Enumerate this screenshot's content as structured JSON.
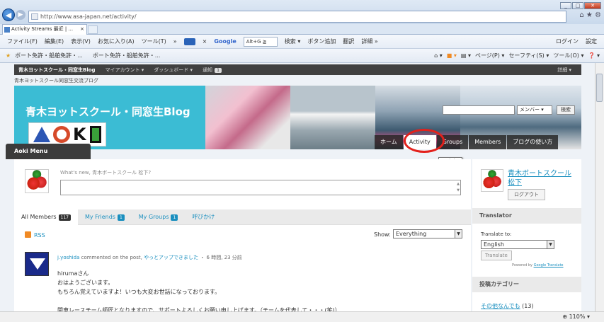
{
  "browser": {
    "url": "http://www.asa-japan.net/activity/",
    "tab_title": "Activity Streams 最近 | ...",
    "tab_close": "×",
    "menu": [
      "ファイル(F)",
      "編集(E)",
      "表示(V)",
      "お気に入り(A)",
      "ツール(T)",
      "»"
    ],
    "toolbar": {
      "google": "Google",
      "search_input": "Alt+G ≧",
      "search_btn": "検索 ▾",
      "addbutton": "ボタン追加",
      "translate": "翻訳",
      "details": "詳細 »",
      "login": "ログイン",
      "settings": "設定",
      "close_x": "×"
    },
    "favorites": [
      "ボート免許・船舶免許・...",
      "ボート免許・船舶免許・..."
    ],
    "command_bar": [
      "ページ(P) ▾",
      "セーフティ(S) ▾",
      "ツール(O) ▾",
      "❓ ▾"
    ],
    "zoom": "110%",
    "window_buttons": [
      "_",
      "□",
      "✕"
    ]
  },
  "adminbar": {
    "site": "青木ヨットスクール・同窓生Blog",
    "account": "マイアカウント ▾",
    "dashboard": "ダッシュボード ▾",
    "notifications": "通知",
    "notif_count": "1",
    "right": "詳細 ▾"
  },
  "site": {
    "tagline": "青木ヨットスクール同窓生交流ブログ",
    "title": "青木ヨットスクール・同窓生Blog",
    "search_select": "メンバー ▾",
    "search_btn": "検索",
    "nav": [
      "ホーム",
      "Activity",
      "Groups",
      "Members",
      "ブログの使い方"
    ],
    "tooltip": "Activity",
    "menu_label": "Aoki Menu"
  },
  "activity": {
    "whats_new": "What's new, 青木ボートスクール 松下?",
    "tabs": [
      {
        "label": "All Members",
        "count": "117"
      },
      {
        "label": "My Friends",
        "count": "1"
      },
      {
        "label": "My Groups",
        "count": "1"
      },
      {
        "label": "呼びかけ",
        "count": ""
      }
    ],
    "rss": "RSS",
    "show_label": "Show:",
    "show_value": "Everything",
    "entry": {
      "user": "j.yoshida",
      "action": "commented on the post,",
      "post": "やっとアップできました",
      "time": "6 時間, 23 分前",
      "lines": [
        "hirumaさん",
        "おはようございます。",
        "もちろん覚えていますよ！いつも大変お世話になっております。",
        "",
        "関東レースチーム師匠となりますので、サポートよろしくお願い申し上げます。（チームを代表して・・・(笑)）"
      ]
    }
  },
  "sidebar": {
    "user": "青木ボートスクール 松下",
    "logout": "ログアウト",
    "translator_title": "Translator",
    "translate_to": "Translate to:",
    "language": "English",
    "translate_btn": "Translate",
    "powered_by": "Powered by",
    "powered_link": "Google Translate",
    "categories_title": "投稿カテゴリー",
    "category_link": "その他なんでも",
    "category_count": "(13)"
  }
}
